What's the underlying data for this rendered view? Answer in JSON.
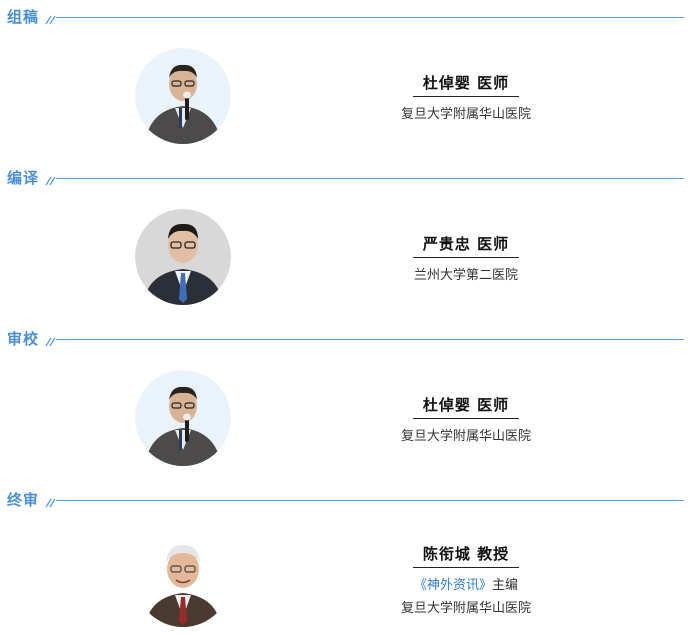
{
  "sections": [
    {
      "title": "组稿",
      "person": {
        "name": "杜倬婴 医师",
        "institution": "复旦大学附属华山医院",
        "photo": "portrait-man-glasses-microphone"
      }
    },
    {
      "title": "编译",
      "person": {
        "name": "严贵忠 医师",
        "institution": "兰州大学第二医院",
        "photo": "portrait-man-glasses-suit"
      }
    },
    {
      "title": "审校",
      "person": {
        "name": "杜倬婴 医师",
        "institution": "复旦大学附属华山医院",
        "photo": "portrait-man-glasses-microphone"
      }
    },
    {
      "title": "终审",
      "person": {
        "name": "陈衔城 教授",
        "journal": "《神外资讯》",
        "role": "主编",
        "institution": "复旦大学附属华山医院",
        "photo": "portrait-elderly-man-glasses"
      }
    }
  ],
  "colors": {
    "accent": "#4a8fd6",
    "line": "#5b9be0",
    "journal_link": "#2f7fd0"
  }
}
